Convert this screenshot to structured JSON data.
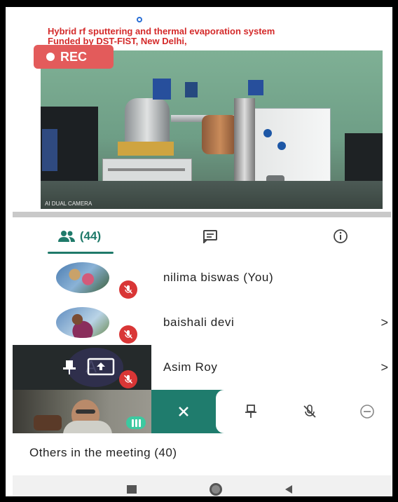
{
  "presentation": {
    "title_line1": "Hybrid rf sputtering and thermal evaporation system",
    "title_line2": "Funded by DST-FIST, New Delhi,",
    "recording_label": "REC",
    "watermark": "AI DUAL CAMERA"
  },
  "tabs": {
    "people_count": "(44)",
    "people_icon": "people-icon",
    "chat_icon": "chat-icon",
    "info_icon": "info-icon",
    "active": "people"
  },
  "participants": [
    {
      "name": "nilima biswas (You)",
      "muted": true,
      "chevron": ""
    },
    {
      "name": "baishali devi",
      "muted": true,
      "chevron": ">"
    },
    {
      "name": "Asim Roy",
      "muted": true,
      "chevron": ">",
      "presenting": true,
      "avatar_letter": "A"
    }
  ],
  "actions": [
    "close-icon",
    "pin-icon",
    "mute-icon",
    "remove-icon"
  ],
  "others_label": "Others in the meeting (40)",
  "colors": {
    "accent": "#1f7c6d",
    "muted": "#d93636",
    "rec": "#e35b5b",
    "title_red": "#d42a2a"
  }
}
